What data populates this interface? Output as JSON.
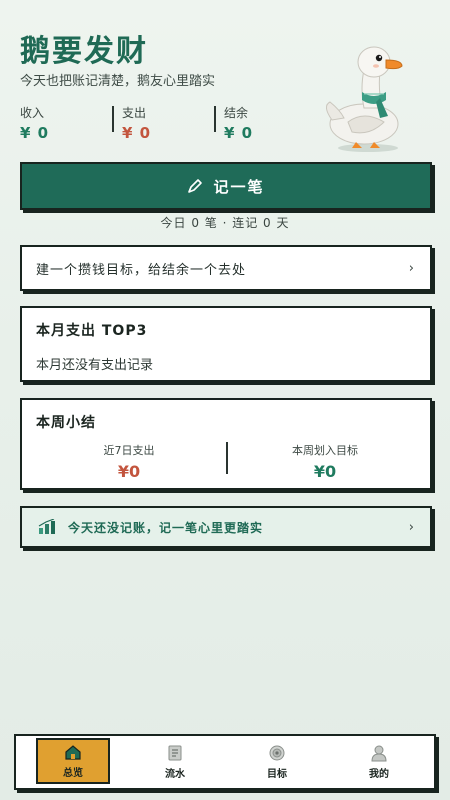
{
  "header": {
    "title": "鹅要发财",
    "subtitle": "今天也把账记清楚，鹅友心里踏实"
  },
  "stats": {
    "income": {
      "label": "收入",
      "value": "¥ 0"
    },
    "expense": {
      "label": "支出",
      "value": "¥ 0"
    },
    "balance": {
      "label": "结余",
      "value": "¥ 0"
    }
  },
  "record_button": {
    "label": "记一笔",
    "icon": "pencil-icon"
  },
  "today_stats": "今日 0 笔 · 连记 0 天",
  "goal_card": {
    "text": "建一个攒钱目标，给结余一个去处",
    "chevron": "›"
  },
  "top3_card": {
    "title": "本月支出 TOP3",
    "empty_text": "本月还没有支出记录"
  },
  "week_card": {
    "title": "本周小结",
    "left": {
      "label": "近7日支出",
      "value": "¥0"
    },
    "right": {
      "label": "本周划入目标",
      "value": "¥0"
    }
  },
  "tip_card": {
    "text": "今天还没记账，记一笔心里更踏实",
    "chevron": "›",
    "icon": "chart-icon"
  },
  "tabs": [
    {
      "label": "总览",
      "icon": "home-icon",
      "active": true
    },
    {
      "label": "流水",
      "icon": "list-icon",
      "active": false
    },
    {
      "label": "目标",
      "icon": "target-icon",
      "active": false
    },
    {
      "label": "我的",
      "icon": "user-icon",
      "active": false
    }
  ],
  "colors": {
    "primary": "#1f6b58",
    "income": "#1f7b5f",
    "expense": "#c3553e",
    "active_tab": "#e0a030"
  }
}
